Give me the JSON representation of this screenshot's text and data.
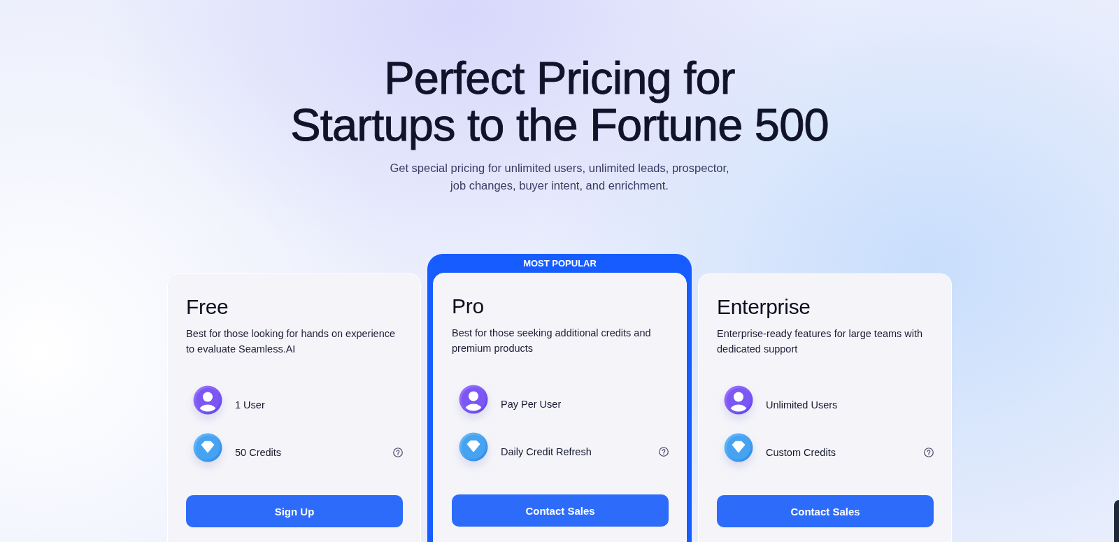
{
  "hero": {
    "title_lines": [
      "Perfect Pricing for",
      "Startups to the Fortune 500"
    ],
    "subtitle_lines": [
      "Get special pricing for unlimited users, unlimited leads, prospector,",
      "job changes, buyer intent, and enrichment."
    ]
  },
  "plans": [
    {
      "name": "Free",
      "featured": false,
      "description": "Best for those looking for hands on experience to evaluate Seamless.AI",
      "features": [
        {
          "kind": "user",
          "label": "1 User",
          "help": false
        },
        {
          "kind": "credits",
          "label": "50 Credits",
          "help": true
        }
      ],
      "button": "Sign Up"
    },
    {
      "name": "Pro",
      "featured": true,
      "badge": "MOST POPULAR",
      "description": "Best for those seeking additional credits and premium products",
      "features": [
        {
          "kind": "user",
          "label": "Pay Per User",
          "help": false
        },
        {
          "kind": "credits",
          "label": "Daily Credit Refresh",
          "help": true
        }
      ],
      "button": "Contact Sales"
    },
    {
      "name": "Enterprise",
      "featured": false,
      "description": "Enterprise-ready features for large teams with dedicated support",
      "features": [
        {
          "kind": "user",
          "label": "Unlimited Users",
          "help": false
        },
        {
          "kind": "credits",
          "label": "Custom Credits",
          "help": true
        }
      ],
      "button": "Contact Sales"
    }
  ]
}
